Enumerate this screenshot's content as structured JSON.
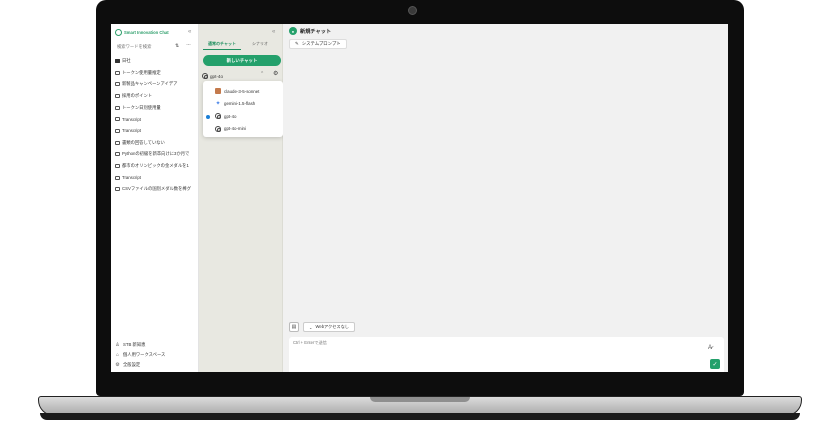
{
  "sidebar": {
    "brand": "Smart Innovation Chat",
    "search_placeholder": "検索ワードを検索",
    "history": [
      {
        "type": "folder",
        "label": "日社"
      },
      {
        "type": "chat",
        "label": "トークン使用量推定"
      },
      {
        "type": "chat",
        "label": "新製品キャンペーンアイデア"
      },
      {
        "type": "chat",
        "label": "採用のポイント"
      },
      {
        "type": "chat",
        "label": "トークン日別使用量"
      },
      {
        "type": "chat",
        "label": "Transcript"
      },
      {
        "type": "chat",
        "label": "Transcript"
      },
      {
        "type": "chat",
        "label": "書類の回答していない"
      },
      {
        "type": "chat",
        "label": "Pythonの初級を新卒向けに3か月で"
      },
      {
        "type": "chat",
        "label": "都市のオリンピックの金メダルを1"
      },
      {
        "type": "chat",
        "label": "Transcript"
      },
      {
        "type": "chat",
        "label": "CSVファイルの国別メダル数を棒グ"
      }
    ],
    "footer": [
      {
        "icon": "user-icon",
        "label": "STB 新知恵"
      },
      {
        "icon": "home-icon",
        "label": "個人用ワークスペース"
      },
      {
        "icon": "settings-icon",
        "label": "全般設定"
      }
    ]
  },
  "modes": {
    "tabs": [
      {
        "label": "通常のチャット",
        "active": true
      },
      {
        "label": "シナリオ",
        "active": false
      }
    ],
    "new_chat": "新しいチャット",
    "selected_model": "gpt-4o",
    "models": [
      {
        "icon": "claude",
        "label": "claude-3-5-sonnet",
        "selected": false
      },
      {
        "icon": "gemini",
        "label": "gemini-1.5-flash",
        "selected": false
      },
      {
        "icon": "openai",
        "label": "gpt-4o",
        "selected": true
      },
      {
        "icon": "openai",
        "label": "gpt-4o-mini",
        "selected": false
      }
    ]
  },
  "main": {
    "title": "新規チャット",
    "system_prompt": "システムプロンプト",
    "web_access": "Webアクセスなし",
    "input_placeholder": "Ctrl + Enterで送信"
  },
  "colors": {
    "accent": "#24a06b",
    "selected": "#1a7fd6"
  }
}
